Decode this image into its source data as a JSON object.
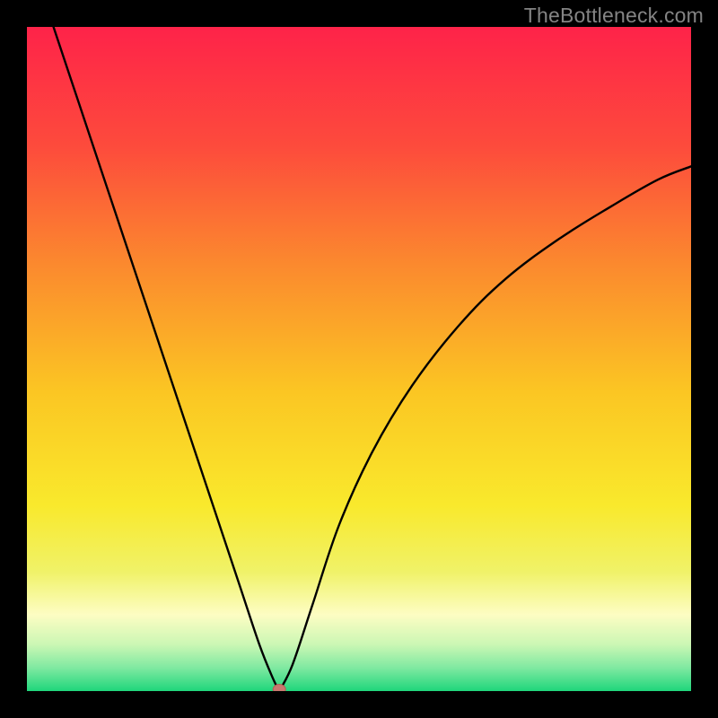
{
  "watermark": "TheBottleneck.com",
  "colors": {
    "frame": "#000000",
    "curve": "#000000",
    "marker_fill": "#c9786f",
    "marker_stroke": "#b45e54",
    "gradient_stops": [
      {
        "offset": 0.0,
        "color": "#fe2349"
      },
      {
        "offset": 0.18,
        "color": "#fd4b3c"
      },
      {
        "offset": 0.36,
        "color": "#fb8a2e"
      },
      {
        "offset": 0.55,
        "color": "#fbc623"
      },
      {
        "offset": 0.72,
        "color": "#f9e92c"
      },
      {
        "offset": 0.82,
        "color": "#f0f268"
      },
      {
        "offset": 0.885,
        "color": "#fdfdc3"
      },
      {
        "offset": 0.93,
        "color": "#cbf7b4"
      },
      {
        "offset": 0.965,
        "color": "#7fe9a1"
      },
      {
        "offset": 1.0,
        "color": "#1fd67b"
      }
    ]
  },
  "chart_data": {
    "type": "line",
    "title": "",
    "xlabel": "",
    "ylabel": "",
    "xlim": [
      0,
      100
    ],
    "ylim": [
      0,
      100
    ],
    "grid": false,
    "minimum_x": 38,
    "left": {
      "x": [
        4,
        8,
        12,
        16,
        20,
        24,
        28,
        32,
        35,
        37,
        38
      ],
      "values": [
        100,
        88,
        76,
        64,
        52,
        40,
        28,
        16,
        7,
        2,
        0
      ]
    },
    "right": {
      "x": [
        38,
        40,
        43,
        47,
        52,
        58,
        65,
        72,
        80,
        88,
        95,
        100
      ],
      "values": [
        0,
        4,
        13,
        25,
        36,
        46,
        55,
        62,
        68,
        73,
        77,
        79
      ]
    },
    "marker": {
      "x": 38,
      "y": 0
    }
  }
}
